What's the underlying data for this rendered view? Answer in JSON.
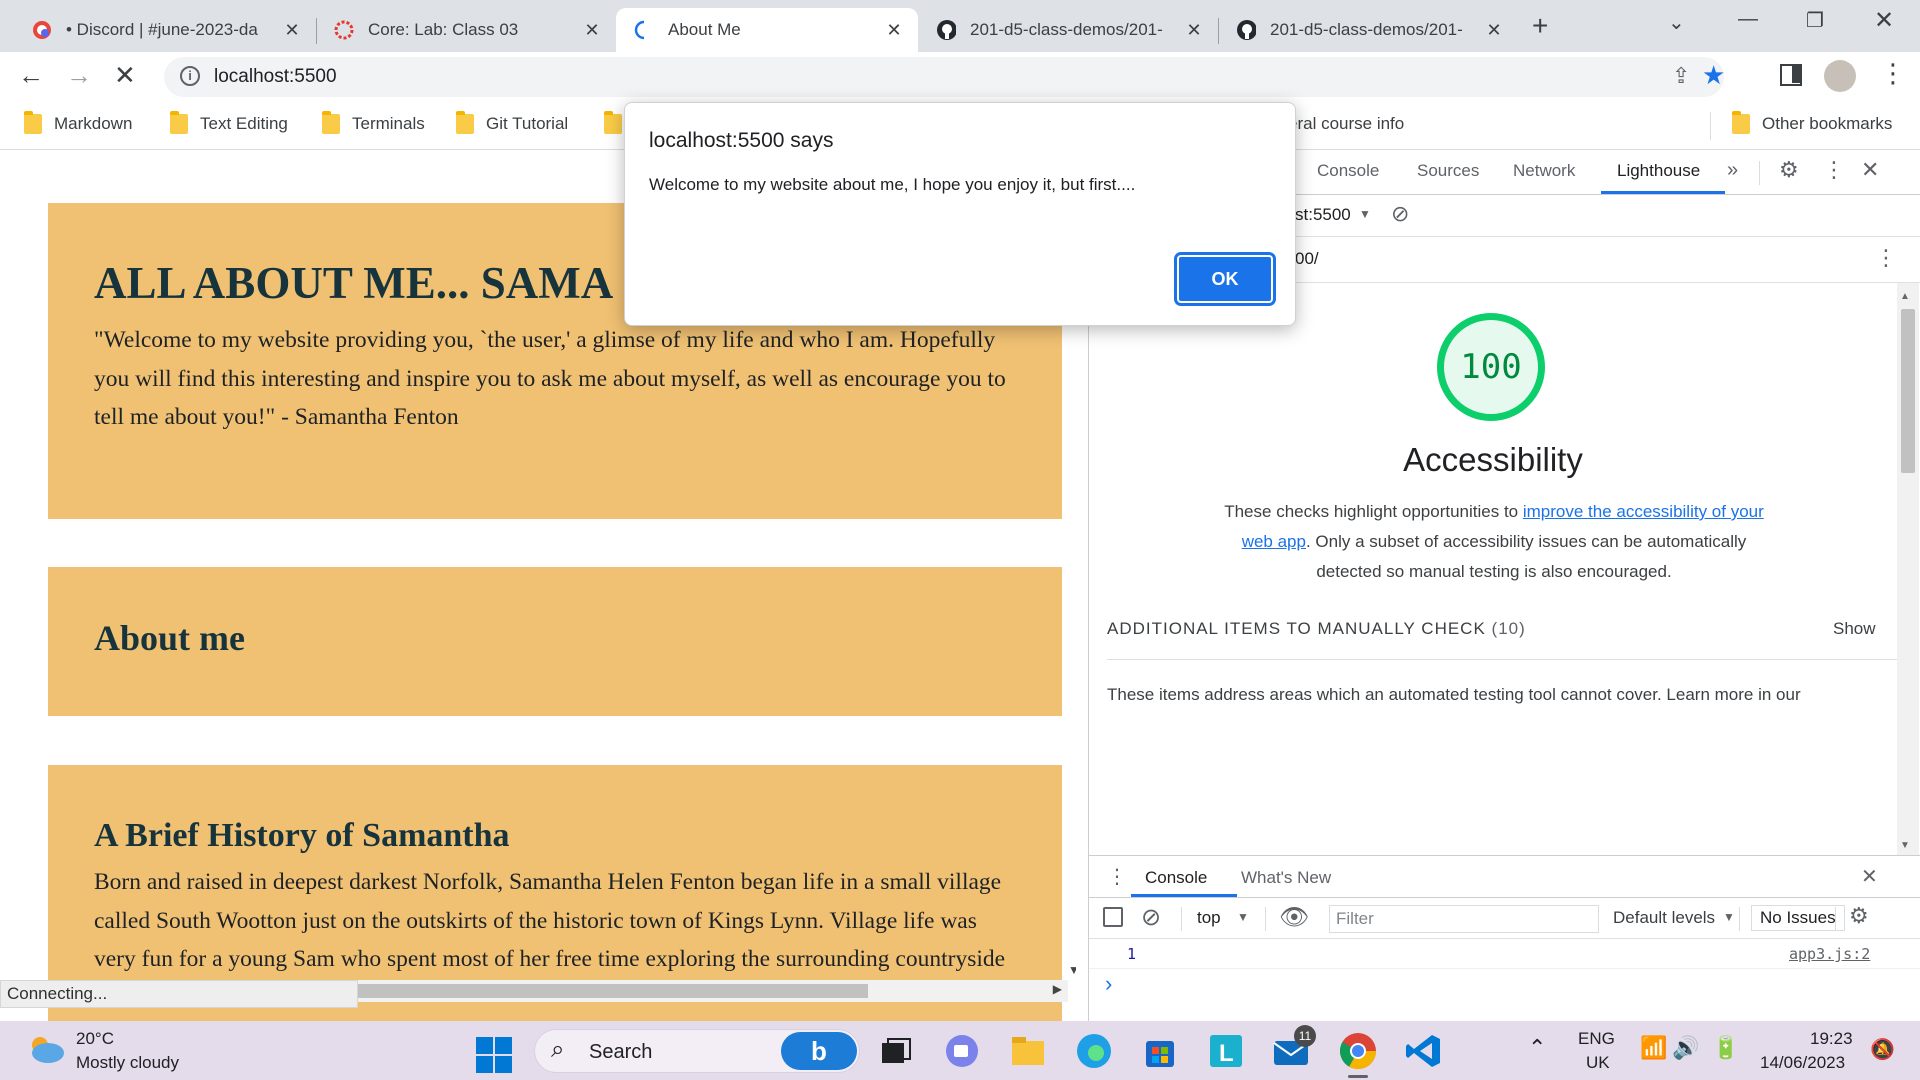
{
  "tabs": [
    {
      "title": "• Discord | #june-2023-da",
      "active": false
    },
    {
      "title": "Core: Lab: Class 03",
      "active": false
    },
    {
      "title": "About Me",
      "active": true
    },
    {
      "title": "201-d5-class-demos/201-",
      "active": false
    },
    {
      "title": "201-d5-class-demos/201-",
      "active": false
    }
  ],
  "address": {
    "url": "localhost:5500"
  },
  "bookmarks": {
    "items": [
      "Markdown",
      "Text Editing",
      "Terminals",
      "Git Tutorial",
      "eral course info"
    ],
    "other": "Other bookmarks"
  },
  "page": {
    "header_title": "ALL ABOUT ME... SAMA",
    "quote_lines": [
      "\"Welcome to my website providing you, `the user,' a glimse of my life and who I am. Hopefully",
      "you will find this interesting and inspire you to ask me about myself, as well as encourage you to",
      "tell me about you!\" - Samantha Fenton"
    ],
    "about_heading": "About me",
    "history_heading": "A Brief History of Samantha",
    "history_lines": [
      "Born and raised in deepest darkest Norfolk, Samantha Helen Fenton began life in a small village",
      "called South Wootton just on the outskirts of the historic town of Kings Lynn. Village life was",
      "very fun for a young Sam who spent most of her free time exploring the surrounding countryside"
    ],
    "section_color": "#f0c173"
  },
  "status_text": "Connecting...",
  "dialog": {
    "title": "localhost:5500 says",
    "message": "Welcome to my website about me, I hope you enjoy it, but first....",
    "ok_label": "OK"
  },
  "devtools": {
    "tabs": [
      "Console",
      "Sources",
      "Network",
      "Lighthouse"
    ],
    "active_tab": "Lighthouse",
    "url_select": "st:5500",
    "url_path": "00/",
    "score": "100",
    "category": "Accessibility",
    "desc_before": "These checks highlight opportunities to ",
    "desc_link": "improve the accessibility of your",
    "desc_link2": "web app",
    "desc_after1": ". Only a subset of accessibility issues can be automatically",
    "desc_after2": "detected so manual testing is also encouraged.",
    "manual_label": "ADDITIONAL ITEMS TO MANUALLY CHECK",
    "manual_count": "(10)",
    "show_label": "Show",
    "manual_desc": "These items address areas which an automated testing tool cannot cover. Learn more in our",
    "drawer_tabs": [
      "Console",
      "What's New"
    ],
    "context": "top",
    "filter_placeholder": "Filter",
    "levels": "Default levels",
    "issues": "No Issues",
    "log_value": "1",
    "log_source": "app3.js:2",
    "prompt": "›"
  },
  "taskbar": {
    "temperature": "20°C",
    "weather": "Mostly cloudy",
    "search_label": "Search",
    "mail_badge": "11",
    "lang": "ENG",
    "region": "UK",
    "time": "19:23",
    "date": "14/06/2023"
  }
}
